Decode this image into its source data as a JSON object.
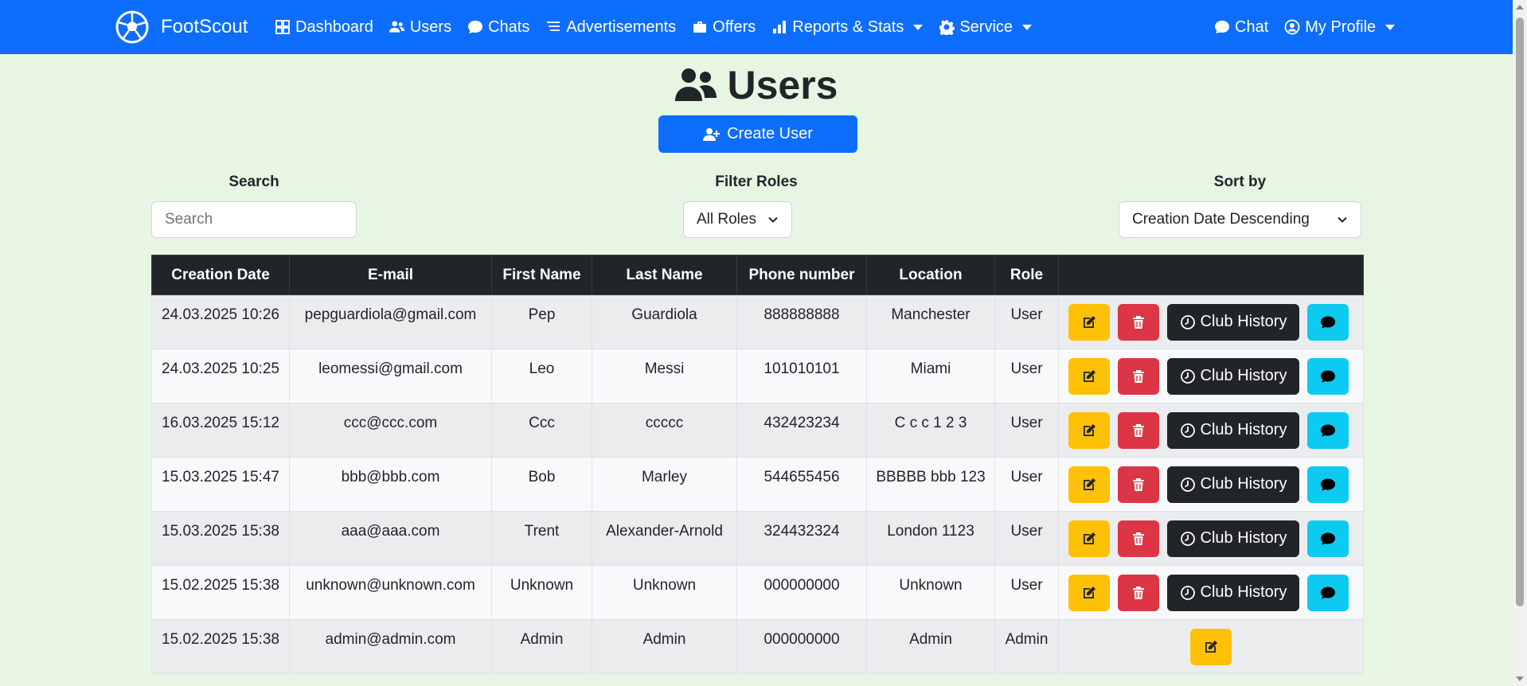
{
  "navbar": {
    "brand": "FootScout",
    "items": [
      {
        "label": "Dashboard",
        "icon": "grid-icon"
      },
      {
        "label": "Users",
        "icon": "users-icon"
      },
      {
        "label": "Chats",
        "icon": "chat-bubble-icon"
      },
      {
        "label": "Advertisements",
        "icon": "list-icon"
      },
      {
        "label": "Offers",
        "icon": "briefcase-icon"
      },
      {
        "label": "Reports & Stats",
        "icon": "bar-chart-icon",
        "dropdown": true
      },
      {
        "label": "Service",
        "icon": "gear-icon",
        "dropdown": true
      }
    ],
    "right": [
      {
        "label": "Chat",
        "icon": "chat-bubble-icon"
      },
      {
        "label": "My Profile",
        "icon": "person-circle-icon",
        "dropdown": true
      }
    ],
    "color": "#0d6efd"
  },
  "page": {
    "title": "Users",
    "create_button": "Create User"
  },
  "filters": {
    "search_label": "Search",
    "search_placeholder": "Search",
    "roles_label": "Filter Roles",
    "roles_value": "All Roles",
    "sort_label": "Sort by",
    "sort_value": "Creation Date Descending"
  },
  "table": {
    "headers": [
      "Creation Date",
      "E-mail",
      "First Name",
      "Last Name",
      "Phone number",
      "Location",
      "Role",
      ""
    ],
    "rows": [
      {
        "date": "24.03.2025 10:26",
        "email": "pepguardiola@gmail.com",
        "first": "Pep",
        "last": "Guardiola",
        "phone": "888888888",
        "location": "Manchester",
        "role": "User"
      },
      {
        "date": "24.03.2025 10:25",
        "email": "leomessi@gmail.com",
        "first": "Leo",
        "last": "Messi",
        "phone": "101010101",
        "location": "Miami",
        "role": "User"
      },
      {
        "date": "16.03.2025 15:12",
        "email": "ccc@ccc.com",
        "first": "Ccc",
        "last": "ccccc",
        "phone": "432423234",
        "location": "C c c 1 2 3",
        "role": "User"
      },
      {
        "date": "15.03.2025 15:47",
        "email": "bbb@bbb.com",
        "first": "Bob",
        "last": "Marley",
        "phone": "544655456",
        "location": "BBBBB bbb 123",
        "role": "User"
      },
      {
        "date": "15.03.2025 15:38",
        "email": "aaa@aaa.com",
        "first": "Trent",
        "last": "Alexander-Arnold",
        "phone": "324432324",
        "location": "London 1123",
        "role": "User"
      },
      {
        "date": "15.02.2025 15:38",
        "email": "unknown@unknown.com",
        "first": "Unknown",
        "last": "Unknown",
        "phone": "000000000",
        "location": "Unknown",
        "role": "User"
      },
      {
        "date": "15.02.2025 15:38",
        "email": "admin@admin.com",
        "first": "Admin",
        "last": "Admin",
        "phone": "000000000",
        "location": "Admin",
        "role": "Admin"
      }
    ],
    "club_history_label": "Club History"
  },
  "colors": {
    "background": "#e6f6e3",
    "edit": "#ffc107",
    "delete": "#dc3545",
    "history": "#212529",
    "chat": "#0dcaf0"
  }
}
